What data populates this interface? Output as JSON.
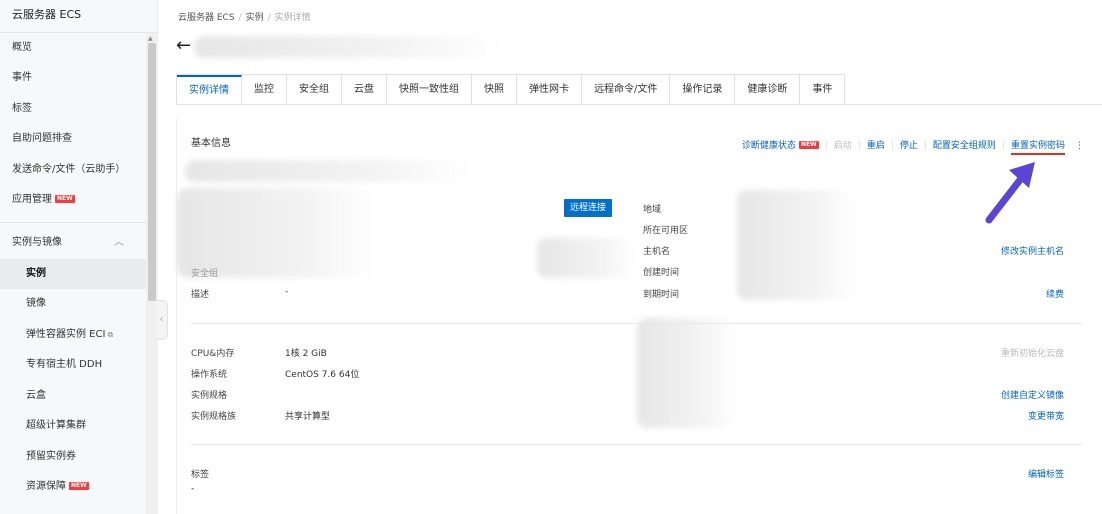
{
  "sidebar": {
    "title": "云服务器 ECS",
    "new_badge": "NEW",
    "items": [
      {
        "label": "概览"
      },
      {
        "label": "事件"
      },
      {
        "label": "标签"
      },
      {
        "label": "自助问题排查"
      },
      {
        "label": "发送命令/文件（云助手）"
      },
      {
        "label": "应用管理"
      }
    ],
    "group": {
      "label": "实例与镜像",
      "children": [
        {
          "label": "实例"
        },
        {
          "label": "镜像"
        },
        {
          "label": "弹性容器实例 ECI"
        },
        {
          "label": "专有宿主机 DDH"
        },
        {
          "label": "云盒"
        },
        {
          "label": "超级计算集群"
        },
        {
          "label": "预留实例券"
        },
        {
          "label": "资源保障"
        }
      ]
    }
  },
  "breadcrumb": [
    "云服务器 ECS",
    "实例",
    "实例详情"
  ],
  "tabs": [
    "实例详情",
    "监控",
    "安全组",
    "云盘",
    "快照一致性组",
    "快照",
    "弹性网卡",
    "远程命令/文件",
    "操作记录",
    "健康诊断",
    "事件"
  ],
  "basic_info": {
    "title": "基本信息",
    "actions": {
      "diagnose": "诊断健康状态",
      "start": "启动",
      "restart": "重启",
      "stop": "停止",
      "configure_sg": "配置安全组规则",
      "reset_password": "重置实例密码",
      "more": "⋮"
    },
    "remote_connect": "远程连接",
    "left_fields": [
      {
        "label": "安全组",
        "value": ""
      },
      {
        "label": "描述",
        "value": "-"
      }
    ],
    "right_fields": [
      {
        "label": "地域"
      },
      {
        "label": "所在可用区"
      },
      {
        "label": "主机名"
      },
      {
        "label": "创建时间"
      },
      {
        "label": "到期时间"
      }
    ],
    "modify_hostname": "修改实例主机名",
    "renew": "续费"
  },
  "config": {
    "fields": [
      {
        "label": "CPU&内存",
        "value": "1核 2 GiB"
      },
      {
        "label": "操作系统",
        "value": "CentOS 7.6 64位"
      },
      {
        "label": "实例规格",
        "value": ""
      },
      {
        "label": "实例规格族",
        "value": "共享计算型"
      }
    ],
    "reinit_disk": "重新初始化云盘",
    "create_image": "创建自定义镜像",
    "change_bandwidth": "变更带宽"
  },
  "tags": {
    "label": "标签",
    "value": "-",
    "edit": "编辑标签"
  },
  "colors": {
    "primary": "#0064c8",
    "badge": "#f03c3c",
    "underline": "#e0301e",
    "arrow": "#5c45d6"
  }
}
